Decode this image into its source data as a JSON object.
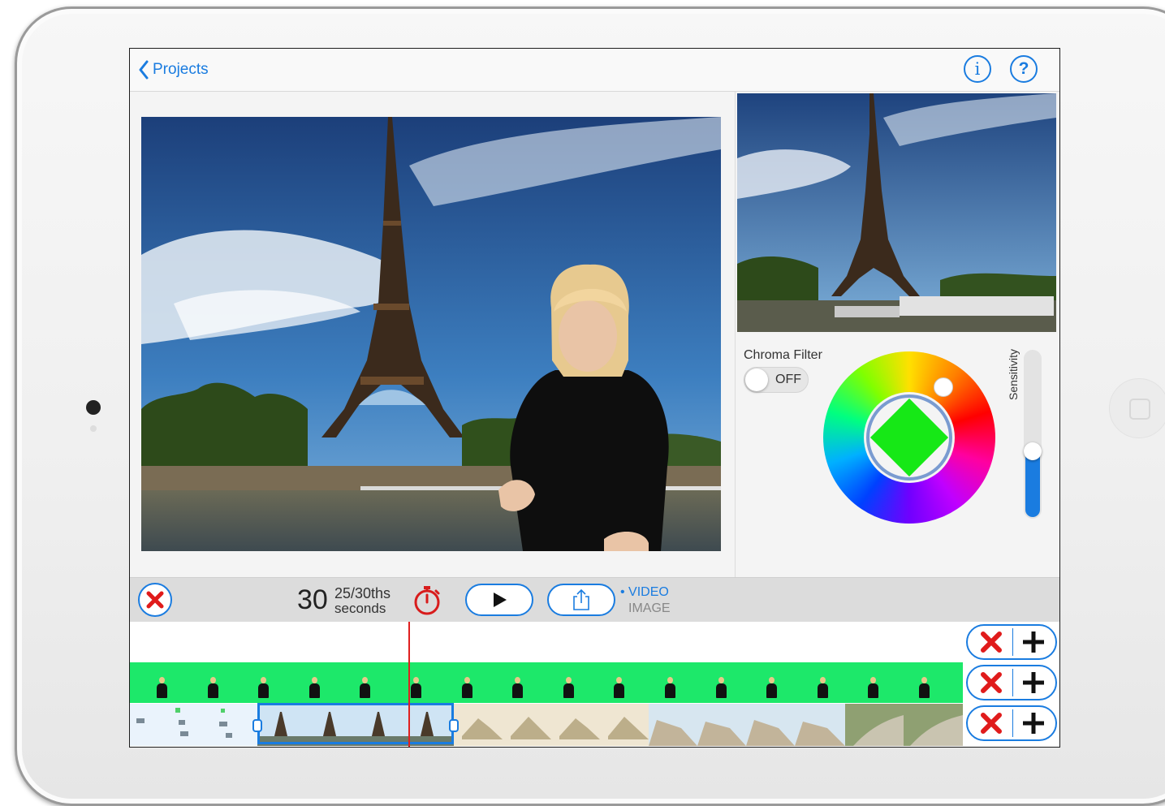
{
  "nav": {
    "back_label": "Projects"
  },
  "chroma": {
    "label": "Chroma Filter",
    "toggle_state": "OFF",
    "key_color": "#16e816",
    "sensitivity_label": "Sensitivity",
    "sensitivity_level": 0.4
  },
  "toolbar": {
    "seconds_whole": "30",
    "seconds_fraction": "25/30ths",
    "seconds_unit": "seconds",
    "mode_video": "• VIDEO",
    "mode_image": "IMAGE"
  },
  "colors": {
    "accent": "#1a7ce0",
    "delete_red": "#e01b1b",
    "green_screen": "#1de86a"
  },
  "icons": [
    "chevron-left-icon",
    "info-icon",
    "help-icon",
    "close-icon",
    "timer-icon",
    "play-icon",
    "share-icon",
    "plus-icon"
  ]
}
